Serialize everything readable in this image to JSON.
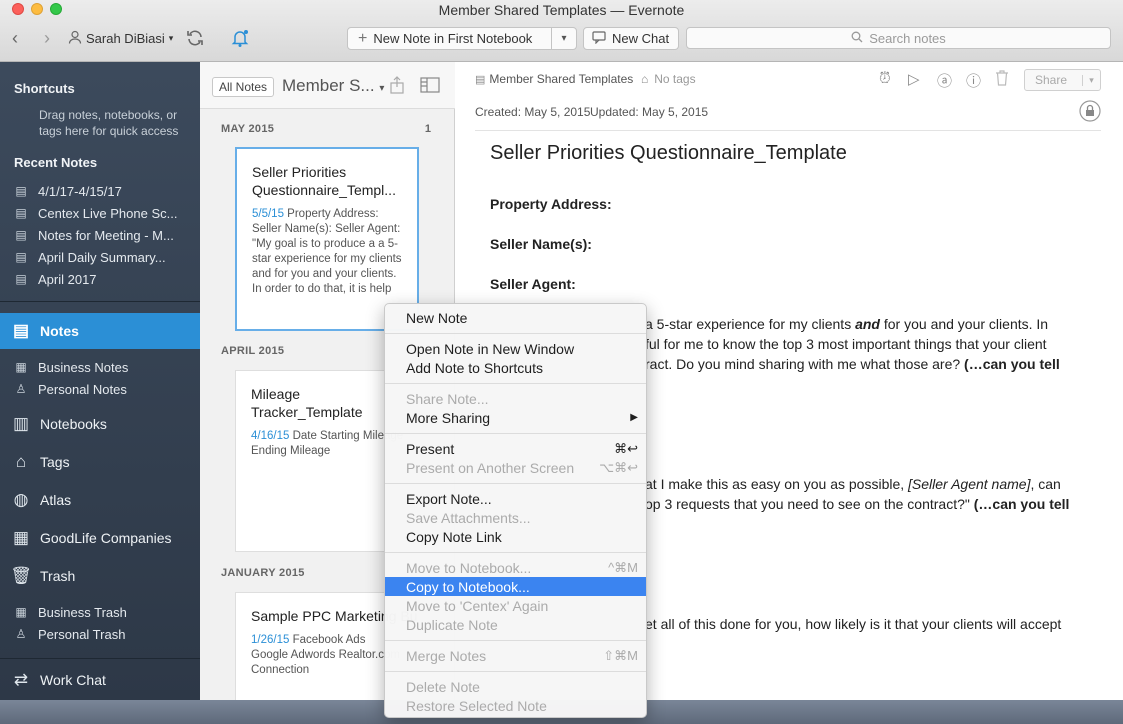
{
  "window": {
    "title": "Member Shared Templates — Evernote"
  },
  "toolbar": {
    "back": "‹",
    "forward": "›",
    "user_name": "Sarah DiBiasi",
    "new_note_label": "New Note in First Notebook",
    "new_chat_label": "New Chat",
    "search_placeholder": "Search notes"
  },
  "sidebar": {
    "shortcuts_label": "Shortcuts",
    "shortcuts_hint": "Drag notes, notebooks, or tags here for quick access",
    "recent_label": "Recent Notes",
    "recent": [
      "4/1/17-4/15/17",
      "Centex Live Phone Sc...",
      "Notes for Meeting - M...",
      "April Daily Summary...",
      "April 2017"
    ],
    "notes": "Notes",
    "business_notes": "Business Notes",
    "personal_notes": "Personal Notes",
    "notebooks": "Notebooks",
    "tags": "Tags",
    "atlas": "Atlas",
    "goodlife": "GoodLife Companies",
    "trash": "Trash",
    "business_trash": "Business Trash",
    "personal_trash": "Personal Trash",
    "work_chat": "Work Chat"
  },
  "notelist": {
    "all_notes": "All Notes",
    "title": "Member S...",
    "sections": [
      {
        "label": "MAY 2015",
        "count": "1"
      },
      {
        "label": "APRIL 2015"
      },
      {
        "label": "JANUARY 2015"
      }
    ],
    "cards": [
      {
        "title": "Seller Priorities Questionnaire_Templ...",
        "date": "5/5/15",
        "snippet": " Property Address: Seller Name(s): Seller Agent: \"My goal is to produce a a 5-star experience for my clients and for you and your clients. In order to do that, it is help"
      },
      {
        "title": "Mileage Tracker_Template",
        "date": "4/16/15",
        "snippet": " Date Starting Mileage Ending Mileage"
      },
      {
        "title": "Sample PPC Marketing Budget (C",
        "date": "1/26/15",
        "snippet": " Facebook Ads Google Adwords Realtor.com Connection"
      }
    ]
  },
  "editor": {
    "notebook": "Member Shared Templates",
    "tags": "No tags",
    "created": "Created: May 5, 2015",
    "updated": "Updated: May 5, 2015",
    "share": "Share",
    "title": "Seller Priorities Questionnaire_Template",
    "fields": [
      "Property Address:",
      "Seller Name(s):",
      "Seller Agent:"
    ],
    "p1_a": "a 5-star experience for my clients ",
    "p1_and": "and",
    "p1_b": " for you and your clients. In",
    "p2": "ful for me to know the top 3 most important things that your client",
    "p3_a": "ract. Do you mind sharing with me what those are? ",
    "p3_bold": "(…can you tell",
    "p4_a": "at I make this as easy on you as possible, ",
    "p4_ital": "[Seller Agent name]",
    "p4_b": ", can",
    "p5_a": "op 3 requests that you need to see on the contract?\" ",
    "p5_bold": "(…can you tell",
    "p6": "et all of this done for you, how likely is it that your clients will accept"
  },
  "context_menu": {
    "new_note": "New Note",
    "open_new_window": "Open Note in New Window",
    "add_shortcuts": "Add Note to Shortcuts",
    "share_note": "Share Note...",
    "more_sharing": "More Sharing",
    "present": "Present",
    "present_shortcut": "⌘↩",
    "present_other": "Present on Another Screen",
    "present_other_shortcut": "⌥⌘↩",
    "export": "Export Note...",
    "save_attachments": "Save Attachments...",
    "copy_link": "Copy Note Link",
    "move_notebook": "Move to Notebook...",
    "move_shortcut": "^⌘M",
    "copy_notebook": "Copy to Notebook...",
    "move_centex": "Move to 'Centex' Again",
    "duplicate": "Duplicate Note",
    "merge": "Merge Notes",
    "merge_shortcut": "⇧⌘M",
    "delete": "Delete Note",
    "restore": "Restore Selected Note"
  }
}
